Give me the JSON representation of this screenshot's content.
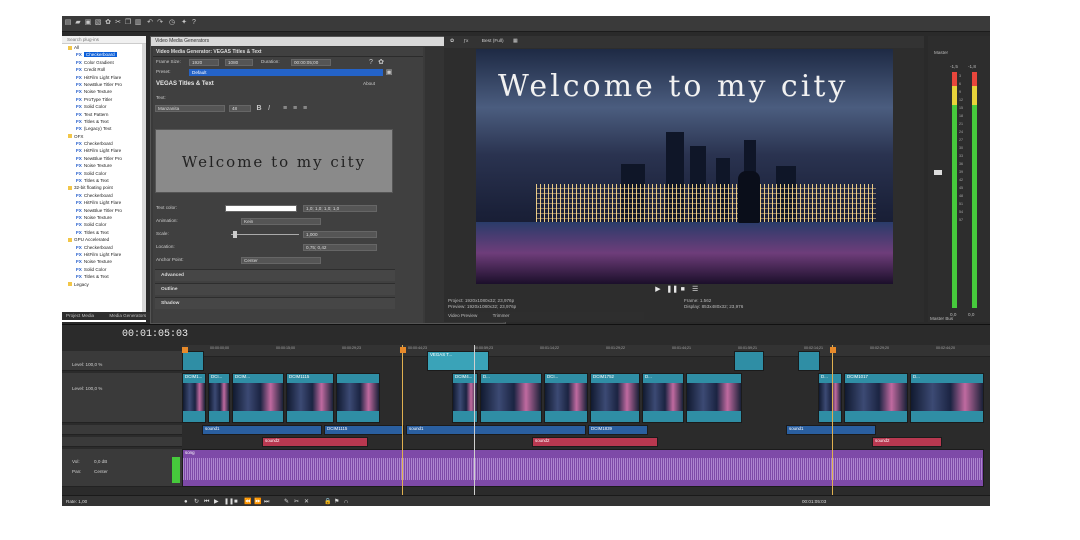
{
  "tree": {
    "search_placeholder": "Search plug-ins",
    "items": [
      {
        "kind": "folder",
        "label": "All"
      },
      {
        "kind": "fx",
        "label": "Checkerboard",
        "selected": true
      },
      {
        "kind": "fx",
        "label": "Color Gradient"
      },
      {
        "kind": "fx",
        "label": "Credit Roll"
      },
      {
        "kind": "fx",
        "label": "HitFilm Light Flare"
      },
      {
        "kind": "fx",
        "label": "NewBlue Titler Pro"
      },
      {
        "kind": "fx",
        "label": "Noise Texture"
      },
      {
        "kind": "fx",
        "label": "ProType Titler"
      },
      {
        "kind": "fx",
        "label": "Solid Color"
      },
      {
        "kind": "fx",
        "label": "Text Pattern"
      },
      {
        "kind": "fx",
        "label": "Titles & Text"
      },
      {
        "kind": "fx",
        "label": "(Legacy) Text"
      },
      {
        "kind": "folder",
        "label": "OFX"
      },
      {
        "kind": "fx",
        "label": "Checkerboard"
      },
      {
        "kind": "fx",
        "label": "HitFilm Light Flare"
      },
      {
        "kind": "fx",
        "label": "NewBlue Titler Pro"
      },
      {
        "kind": "fx",
        "label": "Noise Texture"
      },
      {
        "kind": "fx",
        "label": "Solid Color"
      },
      {
        "kind": "fx",
        "label": "Titles & Text"
      },
      {
        "kind": "folder",
        "label": "32-bit floating point"
      },
      {
        "kind": "fx",
        "label": "Checkerboard"
      },
      {
        "kind": "fx",
        "label": "HitFilm Light Flare"
      },
      {
        "kind": "fx",
        "label": "NewBlue Titler Pro"
      },
      {
        "kind": "fx",
        "label": "Noise Texture"
      },
      {
        "kind": "fx",
        "label": "Solid Color"
      },
      {
        "kind": "fx",
        "label": "Titles & Text"
      },
      {
        "kind": "folder",
        "label": "GPU Accelerated"
      },
      {
        "kind": "fx",
        "label": "Checkerboard"
      },
      {
        "kind": "fx",
        "label": "HitFilm Light Flare"
      },
      {
        "kind": "fx",
        "label": "Noise Texture"
      },
      {
        "kind": "fx",
        "label": "Solid Color"
      },
      {
        "kind": "fx",
        "label": "Titles & Text"
      },
      {
        "kind": "folder",
        "label": "Legacy"
      }
    ],
    "tabs": [
      "Project Media",
      "Media Generators"
    ]
  },
  "generator": {
    "window_title": "Video Media Generators",
    "header": "Video Media Generator:  VEGAS Titles & Text",
    "frame_size_label": "Frame Size:",
    "frame_w": "1920",
    "frame_h": "1080",
    "duration_label": "Duration:",
    "duration": "00:00:05;00",
    "preset_label": "Preset:",
    "preset": "Default",
    "plugin_title": "VEGAS Titles & Text",
    "about": "About",
    "text_label": "Text:",
    "font": "Manzanita",
    "font_size": "48",
    "preview_text": "Welcome to my city",
    "text_color_label": "Text color:",
    "text_color_value": "1,0; 1,0; 1,0; 1,0",
    "animation_label": "Animation:",
    "animation": "Kein",
    "scale_label": "Scale:",
    "scale": "1,000",
    "location_label": "Location:",
    "location": "0,75; 0,42",
    "anchor_label": "Anchor Point:",
    "anchor": "Center",
    "sections": [
      "Advanced",
      "Outline",
      "Shadow"
    ]
  },
  "preview": {
    "quality": "Best (Full)",
    "overlay_text": "Welcome to my city",
    "project_label": "Project:",
    "project_value": "1920x1080x32; 23,976p",
    "preview_label": "Preview:",
    "preview_value": "1920x1080x32; 23,976p",
    "frame_label": "Frame:",
    "frame_value": "1.562",
    "display_label": "Display:",
    "display_value": "853x480x32; 23,976",
    "tabs": [
      "Video Preview",
      "Trimmer"
    ]
  },
  "master": {
    "title": "Master",
    "scale": [
      "3",
      "6",
      "9",
      "12",
      "15",
      "18",
      "21",
      "24",
      "27",
      "30",
      "33",
      "36",
      "39",
      "42",
      "45",
      "48",
      "51",
      "54",
      "57"
    ],
    "level_l": "-1,5",
    "level_r": "-1,8",
    "bottom_l": "0,0",
    "bottom_r": "0,0",
    "tab": "Master Bus"
  },
  "timeline": {
    "timecode": "00:01:05:03",
    "ruler": [
      "00:00:00;00",
      "00:00:15;00",
      "00:00:29;23",
      "00:00:44;23",
      "00:00:59;23",
      "00:01:14;22",
      "00:01:29;22",
      "00:01:44;21",
      "00:01:59;21",
      "00:02:14;21",
      "00:02:29;20",
      "00:02:44;20"
    ],
    "level1": "Level: 100,0 %",
    "level2": "Level: 100,0 %",
    "vol_label": "Vol:",
    "vol_value": "0,0 dB",
    "pan_label": "Pan:",
    "pan_value": "Center",
    "rate_label": "Rate: 1,00",
    "title_clip": "VEGAS T...",
    "video_clips": [
      "DCIM1...",
      "DCI...",
      "DCIM...",
      "DCIM1115",
      "",
      "DCIM4...",
      "D...",
      "DCI...",
      "DCIM1752",
      "D...",
      "",
      "D...",
      "DCIM1017",
      "D..."
    ],
    "audio1": [
      "sound1",
      "DCIM1115",
      "sound1",
      "DCIM1839",
      "sound1"
    ],
    "audio2": [
      "sound2",
      "sound2",
      "sound2"
    ],
    "song": "song",
    "status_timecode": "00:01:05:03"
  }
}
